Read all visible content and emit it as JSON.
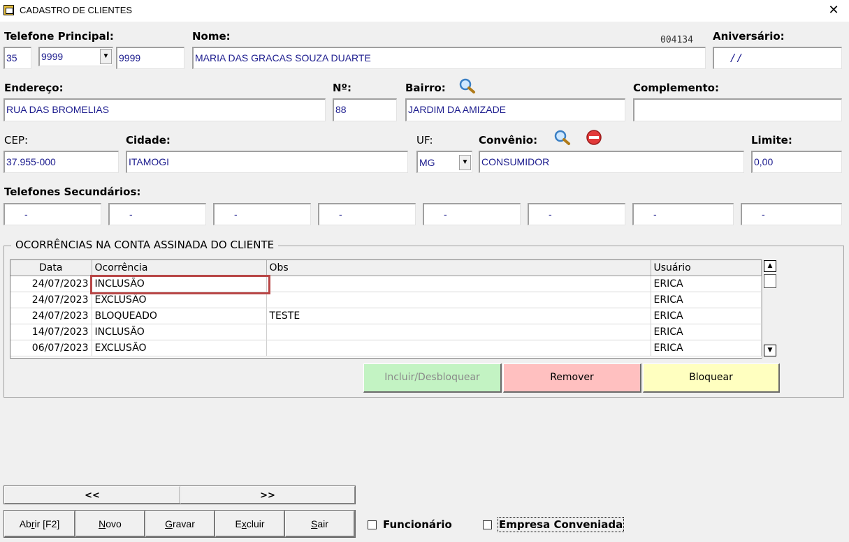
{
  "window": {
    "title": "CADASTRO DE CLIENTES",
    "close_glyph": "✕",
    "icon": "app-icon"
  },
  "labels": {
    "telefone_principal": "Telefone Principal:",
    "nome": "Nome:",
    "aniversario": "Aniversário:",
    "endereco": "Endereço:",
    "numero": "Nº:",
    "bairro": "Bairro:",
    "complemento": "Complemento:",
    "cep": "CEP:",
    "cidade": "Cidade:",
    "uf": "UF:",
    "convenio": "Convênio:",
    "limite": "Limite:",
    "telefones_secundarios": "Telefones Secundários:"
  },
  "fields": {
    "ddd": "35",
    "prefixo": "9999",
    "numero_tel": "9999",
    "codigo": "004134",
    "nome": "MARIA DAS GRACAS SOUZA DUARTE",
    "aniversario": "/ /",
    "endereco": "RUA DAS BROMELIAS",
    "numero": "88",
    "bairro": "JARDIM DA AMIZADE",
    "complemento": "",
    "cep": "37.955-000",
    "cidade": "ITAMOGI",
    "uf": "MG",
    "convenio": "CONSUMIDOR",
    "limite": "0,00",
    "secundarios": [
      "-",
      "-",
      "-",
      "-",
      "-",
      "-",
      "-",
      "-"
    ]
  },
  "ocorrencias": {
    "group_title": "OCORRÊNCIAS NA CONTA ASSINADA DO CLIENTE",
    "columns": [
      "Data",
      "Ocorrência",
      "Obs",
      "Usuário"
    ],
    "rows": [
      [
        "24/07/2023",
        "INCLUSÃO",
        "",
        "ERICA"
      ],
      [
        "24/07/2023",
        "EXCLUSÃO",
        "",
        "ERICA"
      ],
      [
        "24/07/2023",
        "BLOQUEADO",
        "TESTE",
        "ERICA"
      ],
      [
        "14/07/2023",
        "INCLUSÃO",
        "",
        "ERICA"
      ],
      [
        "06/07/2023",
        "EXCLUSÃO",
        "",
        "ERICA"
      ]
    ],
    "buttons": {
      "incluir": "Incluir/Desbloquear",
      "remover": "Remover",
      "bloquear": "Bloquear"
    }
  },
  "nav": {
    "prev": "<<",
    "next": ">>"
  },
  "actions": {
    "abrir_pre": "Ab",
    "abrir_u": "r",
    "abrir_post": "ir [F2]",
    "novo_u": "N",
    "novo_post": "ovo",
    "gravar_u": "G",
    "gravar_post": "ravar",
    "excluir_pre": "E",
    "excluir_u": "x",
    "excluir_post": "cluir",
    "sair_u": "S",
    "sair_post": "air"
  },
  "checkboxes": {
    "funcionario": "Funcionário",
    "empresa_conveniada": "Empresa Conveniada"
  }
}
